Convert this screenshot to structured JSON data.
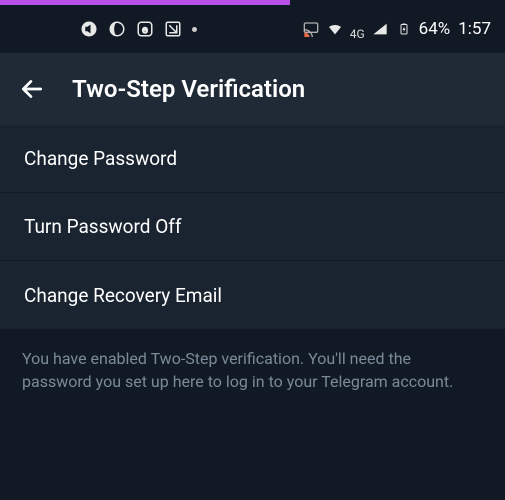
{
  "statusbar": {
    "network_label": "4G",
    "battery_percent": "64%",
    "time": "1:57"
  },
  "header": {
    "title": "Two-Step Verification"
  },
  "options": [
    {
      "label": "Change Password"
    },
    {
      "label": "Turn Password Off"
    },
    {
      "label": "Change Recovery Email"
    }
  ],
  "footnote": "You have enabled Two-Step verification. You'll need the password you set up here to log in to your Telegram account."
}
